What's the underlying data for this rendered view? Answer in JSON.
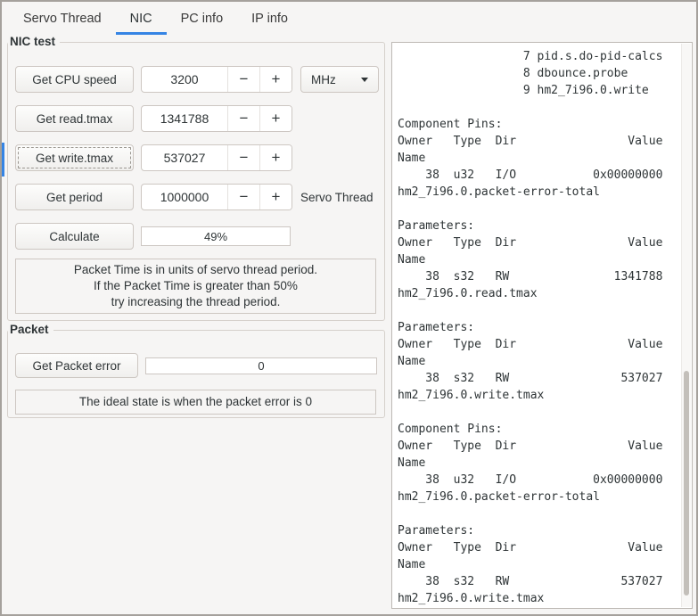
{
  "tabs": {
    "servo_thread": "Servo Thread",
    "nic": "NIC",
    "pc_info": "PC info",
    "ip_info": "IP info"
  },
  "spin": {
    "minus": "−",
    "plus": "+"
  },
  "nic_test": {
    "title": "NIC test",
    "cpu": {
      "button": "Get CPU speed",
      "value": "3200",
      "unit": "MHz"
    },
    "read": {
      "button": "Get read.tmax",
      "value": "1341788"
    },
    "write": {
      "button": "Get write.tmax",
      "value": "537027"
    },
    "period": {
      "button": "Get period",
      "value": "1000000",
      "label": "Servo Thread"
    },
    "calculate_button": "Calculate",
    "progress_value": "49%",
    "note": "Packet Time is in units of servo thread period.\nIf the Packet Time is greater than 50%\ntry increasing the thread period."
  },
  "packet": {
    "title": "Packet",
    "button": "Get Packet error",
    "value": "0",
    "note": "The ideal state is when the packet error is 0"
  },
  "output": {
    "text": "                  7 pid.s.do-pid-calcs\n                  8 dbounce.probe\n                  9 hm2_7i96.0.write\n\nComponent Pins:\nOwner   Type  Dir                Value\nName\n    38  u32   I/O           0x00000000\nhm2_7i96.0.packet-error-total\n\nParameters:\nOwner   Type  Dir                Value\nName\n    38  s32   RW               1341788\nhm2_7i96.0.read.tmax\n\nParameters:\nOwner   Type  Dir                Value\nName\n    38  s32   RW                537027\nhm2_7i96.0.write.tmax\n\nComponent Pins:\nOwner   Type  Dir                Value\nName\n    38  u32   I/O           0x00000000\nhm2_7i96.0.packet-error-total\n\nParameters:\nOwner   Type  Dir                Value\nName\n    38  s32   RW                537027\nhm2_7i96.0.write.tmax"
  },
  "colors": {
    "accent": "#3584e4",
    "window_bg": "#f6f5f4",
    "border": "#cdc7c2",
    "text": "#2e3436"
  }
}
